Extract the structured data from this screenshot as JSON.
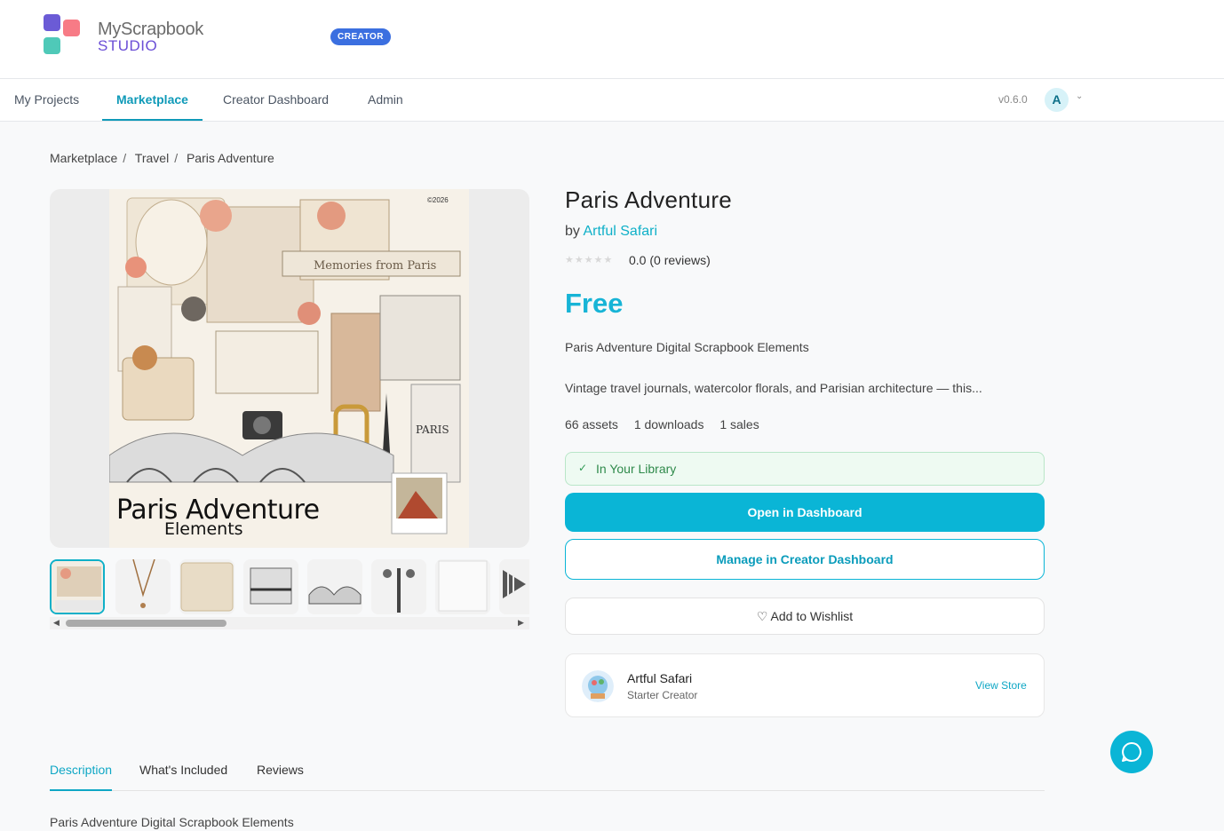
{
  "brand": {
    "line1": "MyScrapbook",
    "line2": "STUDIO",
    "badge": "CREATOR"
  },
  "nav": {
    "items": [
      {
        "label": "My Projects"
      },
      {
        "label": "Marketplace",
        "active": true
      },
      {
        "label": "Creator Dashboard"
      },
      {
        "label": "Admin"
      }
    ],
    "version": "v0.6.0",
    "avatar_initial": "A"
  },
  "breadcrumb": [
    "Marketplace",
    "Travel",
    "Paris Adventure"
  ],
  "gallery": {
    "hero_caption_line1": "Paris Adventure",
    "hero_caption_line2": "Elements",
    "hero_copyright": "©2026",
    "selected_thumb": 1
  },
  "product": {
    "title": "Paris Adventure",
    "by_prefix": "by",
    "creator": "Artful Safari",
    "rating_text": "0.0 (0 reviews)",
    "rating": 0,
    "price": "Free",
    "subtitle": "Paris Adventure Digital Scrapbook Elements",
    "description": "Vintage travel journals, watercolor florals, and Parisian architecture — this...",
    "stats": {
      "assets": "66 assets",
      "downloads": "1 downloads",
      "sales": "1 sales"
    }
  },
  "actions": {
    "library_status": "In Your Library",
    "open_dashboard": "Open in Dashboard",
    "manage": "Manage in Creator Dashboard",
    "wishlist": "♡ Add to Wishlist"
  },
  "store": {
    "name": "Artful Safari",
    "tier": "Starter Creator",
    "view": "View Store"
  },
  "tabs": [
    {
      "label": "Description",
      "active": true
    },
    {
      "label": "What's Included"
    },
    {
      "label": "Reviews"
    }
  ],
  "tab_content": "Paris Adventure Digital Scrapbook Elements",
  "colors": {
    "accent": "#0ab5d6",
    "brand_purple": "#6b4fd6",
    "badge_blue": "#3b6fe0",
    "success_green": "#2f8a4b"
  }
}
